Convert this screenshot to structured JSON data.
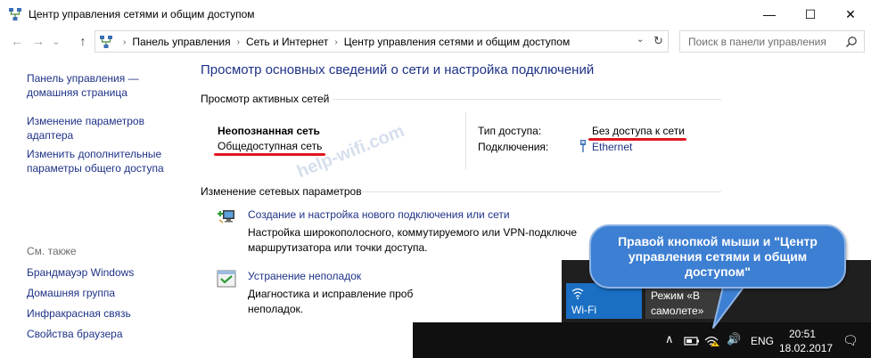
{
  "window": {
    "title": "Центр управления сетями и общим доступом",
    "minimize_glyph": "—",
    "maximize_glyph": "☐",
    "close_glyph": "✕"
  },
  "nav": {
    "back_glyph": "←",
    "forward_glyph": "→",
    "history_glyph": "⌄",
    "up_glyph": "↑",
    "breadcrumbs": [
      "Панель управления",
      "Сеть и Интернет",
      "Центр управления сетями и общим доступом"
    ],
    "separator": "›",
    "dropdown_glyph": "⌄",
    "refresh_glyph": "↻",
    "search_placeholder": "Поиск в панели управления"
  },
  "sidebar": {
    "links": [
      {
        "line1": "Панель управления —",
        "line2": "домашняя страница"
      },
      {
        "line1": "Изменение параметров",
        "line2": "адаптера"
      },
      {
        "line1": "Изменить дополнительные",
        "line2": "параметры общего доступа"
      }
    ],
    "see_also_label": "См. также",
    "see_also": [
      "Брандмауэр Windows",
      "Домашняя группа",
      "Инфракрасная связь",
      "Свойства браузера"
    ]
  },
  "main": {
    "heading": "Просмотр основных сведений о сети и настройка подключений",
    "active_networks_label": "Просмотр активных сетей",
    "network": {
      "name": "Неопознанная сеть",
      "type": "Общедоступная сеть",
      "access_label": "Тип доступа:",
      "access_value": "Без доступа к сети",
      "connections_label": "Подключения:",
      "connections_value": "Ethernet"
    },
    "change_settings_label": "Изменение сетевых параметров",
    "tasks": [
      {
        "link": "Создание и настройка нового подключения или сети",
        "desc1": "Настройка широкополосного, коммутируемого или VPN-подключе",
        "desc2": "маршрутизатора или точки доступа."
      },
      {
        "link": "Устранение неполадок",
        "desc1": "Диагностика и исправление проб",
        "desc2": "неполадок."
      }
    ]
  },
  "watermark": "help-wifi.com",
  "taskbar": {
    "wifi_tile": "Wi-Fi",
    "airplane_tile_line1": "Режим «В",
    "airplane_tile_line2": "самолете»",
    "chevron_glyph": "∧",
    "volume_glyph": "🔊",
    "language": "ENG",
    "time": "20:51",
    "date": "18.02.2017",
    "notification_glyph": "🗨"
  },
  "callout": {
    "text": "Правой кнопкой мыши и \"Центр управления сетями и общим доступом\""
  },
  "colors": {
    "link": "#1e3287",
    "underline_red": "#e0161f",
    "callout_blue": "#3d7fd2",
    "wifi_tile": "#1a6fc4",
    "taskbar": "#101010"
  }
}
